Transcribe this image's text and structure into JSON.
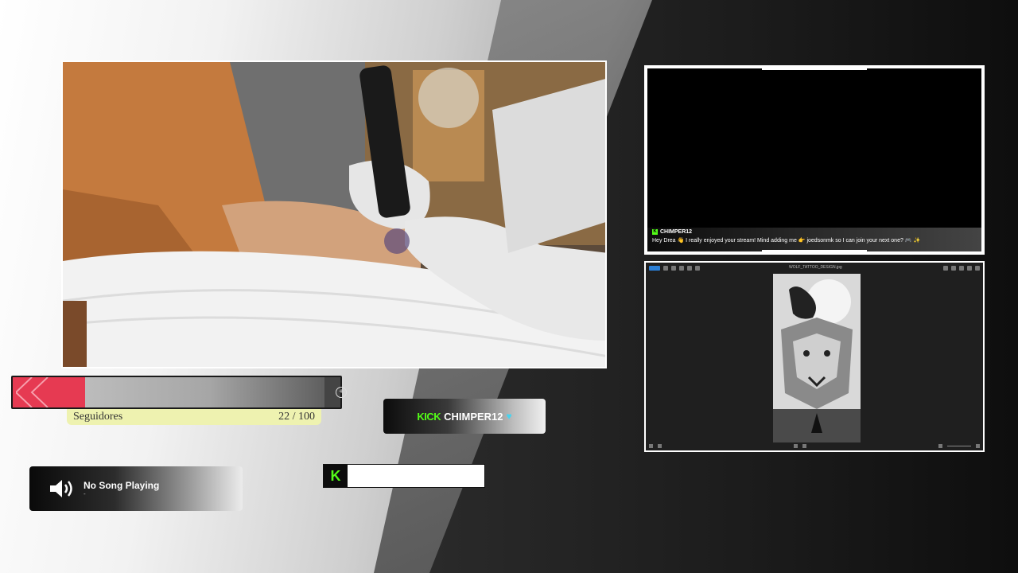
{
  "follower_goal": {
    "label": "Seguidores",
    "current": 22,
    "goal": 100,
    "count_text": "22 / 100",
    "fill_fraction": 0.22,
    "fill_color": "#e63a52"
  },
  "kick_badge": {
    "brand": "KICK",
    "username": "CHIMPER12",
    "heart_icon": "heart-icon",
    "brand_color": "#53fc18"
  },
  "now_playing": {
    "title": "No Song Playing",
    "subtitle": "-",
    "icon": "speaker-icon"
  },
  "kick_small": {
    "logo": "K"
  },
  "chat": {
    "username": "CHIMPER12",
    "message": "Hey Drea 👋 I really enjoyed your stream! Mind adding me 👉 joedsonmk so I can join your next one? 🎮 ✨"
  },
  "image_viewer": {
    "title": "WOLF_TATTOO_DESIGN.jpg",
    "subject": "wolf-and-crow-tattoo-design"
  },
  "camera": {
    "subject": "tattoo-session-webcam"
  }
}
